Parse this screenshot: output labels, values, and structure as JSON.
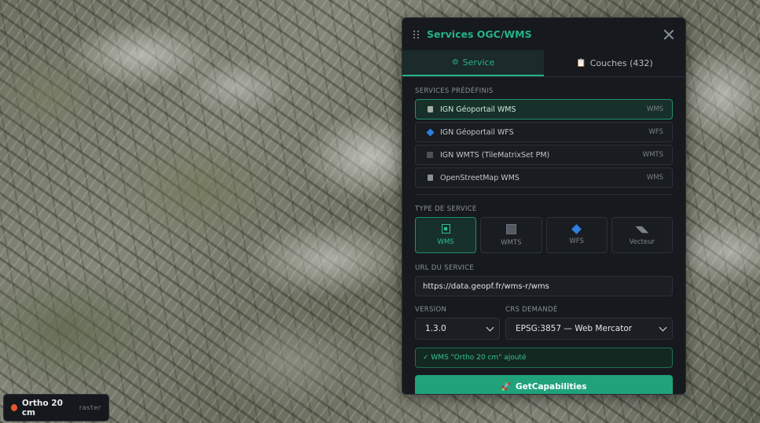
{
  "panel": {
    "title": "Services OGC/WMS",
    "tabs": [
      {
        "icon": "⚙",
        "label": "Service"
      },
      {
        "icon": "📋",
        "label": "Couches (432)"
      }
    ]
  },
  "predefined": {
    "label": "SERVICES PRÉDÉFINIS",
    "items": [
      {
        "name": "IGN Géoportail WMS",
        "tag": "WMS",
        "icon": "grid-icon"
      },
      {
        "name": "IGN Géoportail WFS",
        "tag": "WFS",
        "icon": "diamond-icon"
      },
      {
        "name": "IGN WMTS (TileMatrixSet PM)",
        "tag": "WMTS",
        "icon": "square-icon"
      },
      {
        "name": "OpenStreetMap WMS",
        "tag": "WMS",
        "icon": "grid-icon"
      }
    ]
  },
  "service_type": {
    "label": "TYPE DE SERVICE",
    "options": [
      {
        "label": "WMS"
      },
      {
        "label": "WMTS"
      },
      {
        "label": "WFS"
      },
      {
        "label": "Vecteur"
      }
    ]
  },
  "url": {
    "label": "URL DU SERVICE",
    "value": "https://data.geopf.fr/wms-r/wms"
  },
  "version": {
    "label": "VERSION",
    "value": "1.3.0"
  },
  "crs": {
    "label": "CRS DEMANDÉ",
    "value": "EPSG:3857 — Web Mercator"
  },
  "status": "✓ WMS \"Ortho 20 cm\" ajouté",
  "action": {
    "icon": "🚀",
    "label": "GetCapabilities"
  },
  "layer_chip": {
    "name": "Ortho 20 cm",
    "type": "raster",
    "color": "#e5582b"
  },
  "colors": {
    "accent": "#26b386",
    "panel_bg": "#161a1f"
  }
}
